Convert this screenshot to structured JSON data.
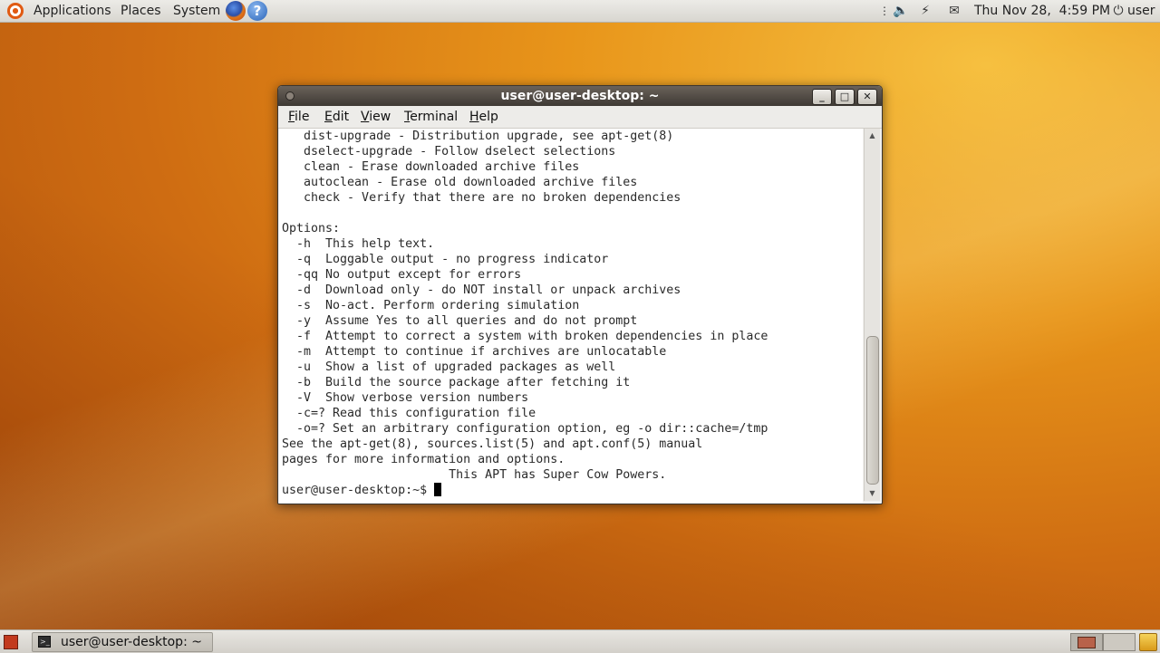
{
  "top_panel": {
    "menus": [
      "Applications",
      "Places",
      "System"
    ],
    "launchers": [
      "firefox-icon",
      "help-icon"
    ],
    "help_glyph": "?",
    "clock": "Thu Nov 28,  4:59 PM",
    "user": "user",
    "tray_icons": [
      "volume-icon",
      "network-icon",
      "mail-icon",
      "power-icon"
    ]
  },
  "terminal": {
    "title": "user@user-desktop: ~",
    "menu": {
      "file": {
        "accel": "F",
        "rest": "ile"
      },
      "edit": {
        "accel": "E",
        "rest": "dit"
      },
      "view": {
        "accel": "V",
        "rest": "iew"
      },
      "terminal": {
        "accel": "T",
        "rest": "erminal"
      },
      "help": {
        "accel": "H",
        "rest": "elp"
      }
    },
    "lines": [
      "   dist-upgrade - Distribution upgrade, see apt-get(8)",
      "   dselect-upgrade - Follow dselect selections",
      "   clean - Erase downloaded archive files",
      "   autoclean - Erase old downloaded archive files",
      "   check - Verify that there are no broken dependencies",
      "",
      "Options:",
      "  -h  This help text.",
      "  -q  Loggable output - no progress indicator",
      "  -qq No output except for errors",
      "  -d  Download only - do NOT install or unpack archives",
      "  -s  No-act. Perform ordering simulation",
      "  -y  Assume Yes to all queries and do not prompt",
      "  -f  Attempt to correct a system with broken dependencies in place",
      "  -m  Attempt to continue if archives are unlocatable",
      "  -u  Show a list of upgraded packages as well",
      "  -b  Build the source package after fetching it",
      "  -V  Show verbose version numbers",
      "  -c=? Read this configuration file",
      "  -o=? Set an arbitrary configuration option, eg -o dir::cache=/tmp",
      "See the apt-get(8), sources.list(5) and apt.conf(5) manual",
      "pages for more information and options.",
      "                       This APT has Super Cow Powers."
    ],
    "prompt": "user@user-desktop:~$ "
  },
  "bottom_panel": {
    "task": "user@user-desktop: ~",
    "workspaces": 2,
    "active_workspace": 1
  },
  "colors": {
    "panel_bg": "#dedcd7",
    "titlebar": "#4a443e",
    "terminal_bg": "#ffffff",
    "terminal_fg": "#2a2a2a"
  }
}
